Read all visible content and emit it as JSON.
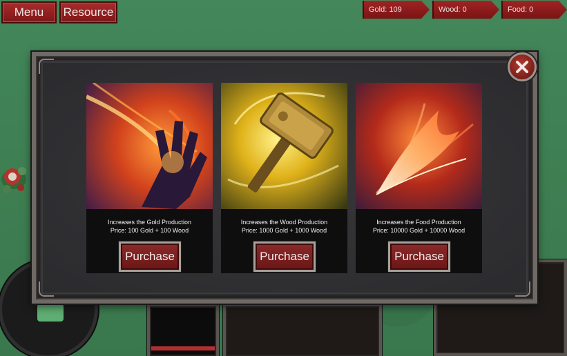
{
  "top_buttons": {
    "menu_label": "Menu",
    "resource_label": "Resource"
  },
  "resources": {
    "gold": "Gold: 109",
    "wood": "Wood: 0",
    "food": "Food: 0"
  },
  "shop": {
    "cards": [
      {
        "description": "Increases the Gold Production",
        "price": "Price: 100 Gold + 100 Wood",
        "button": "Purchase",
        "icon": "fire-hand-icon"
      },
      {
        "description": "Increases the Wood Production",
        "price": "Price: 1000 Gold + 1000 Wood",
        "button": "Purchase",
        "icon": "golden-hammer-icon"
      },
      {
        "description": "Increases the Food Production",
        "price": "Price: 10000 Gold + 10000 Wood",
        "button": "Purchase",
        "icon": "flame-feather-icon"
      }
    ],
    "close_icon": "close-icon"
  },
  "colors": {
    "accent_red": "#8c2a2a",
    "grass": "#3f8051",
    "panel": "#2e2e30"
  }
}
